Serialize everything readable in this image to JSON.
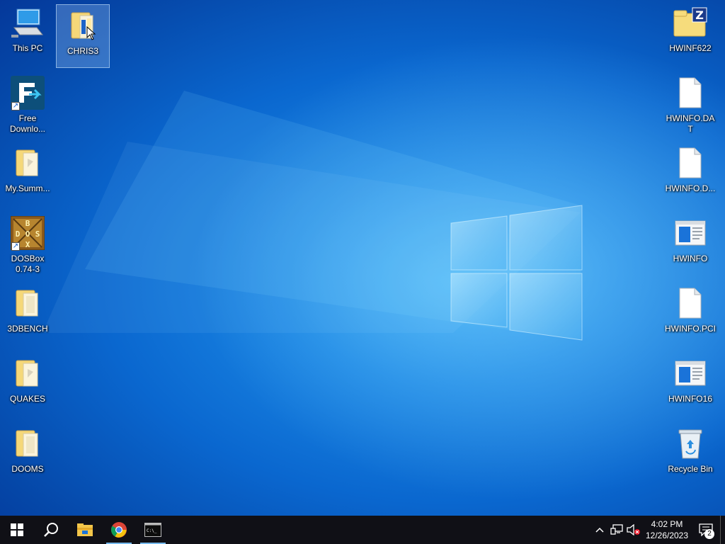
{
  "desktop": {
    "left_icons": [
      {
        "label": "This PC",
        "icon": "computer-icon"
      },
      {
        "label": "CHRIS3",
        "icon": "folder-icon",
        "selected": true
      },
      {
        "label": "Free Downlo...",
        "icon": "free-download-manager-icon"
      },
      {
        "label": "My.Summ...",
        "icon": "folder-icon"
      },
      {
        "label": "DOSBox 0.74-3",
        "icon": "dosbox-icon"
      },
      {
        "label": "3DBENCH",
        "icon": "folder-icon"
      },
      {
        "label": "QUAKES",
        "icon": "folder-icon"
      },
      {
        "label": "DOOMS",
        "icon": "folder-icon"
      }
    ],
    "right_icons": [
      {
        "label": "HWINF622",
        "icon": "zip-folder-icon"
      },
      {
        "label": "HWINFO.DAT",
        "icon": "file-icon"
      },
      {
        "label": "HWINFO.D...",
        "icon": "file-icon"
      },
      {
        "label": "HWINFO",
        "icon": "application-icon"
      },
      {
        "label": "HWINFO.PCI",
        "icon": "file-icon"
      },
      {
        "label": "HWINFO16",
        "icon": "application-icon"
      },
      {
        "label": "Recycle Bin",
        "icon": "recycle-bin-icon"
      }
    ],
    "dosbox_letters": [
      "B",
      "D",
      "O",
      "S",
      "X"
    ],
    "zip_letter": "Z"
  },
  "taskbar": {
    "pinned": [
      {
        "name": "start-button",
        "icon": "windows-logo-icon"
      },
      {
        "name": "search-button",
        "icon": "search-icon"
      },
      {
        "name": "file-explorer-button",
        "icon": "file-explorer-icon"
      },
      {
        "name": "chrome-button",
        "icon": "chrome-icon",
        "running": true
      },
      {
        "name": "command-prompt-button",
        "icon": "cmd-icon",
        "running": true
      }
    ],
    "cmd_prompt_glyph": "C:\\_",
    "tray": {
      "chevron": "^",
      "time": "4:02 PM",
      "date": "12/26/2023",
      "notification_count": "2"
    }
  },
  "colors": {
    "taskbar": "#101016",
    "accent": "#76b9ed",
    "desktop": "#0a67cf"
  }
}
